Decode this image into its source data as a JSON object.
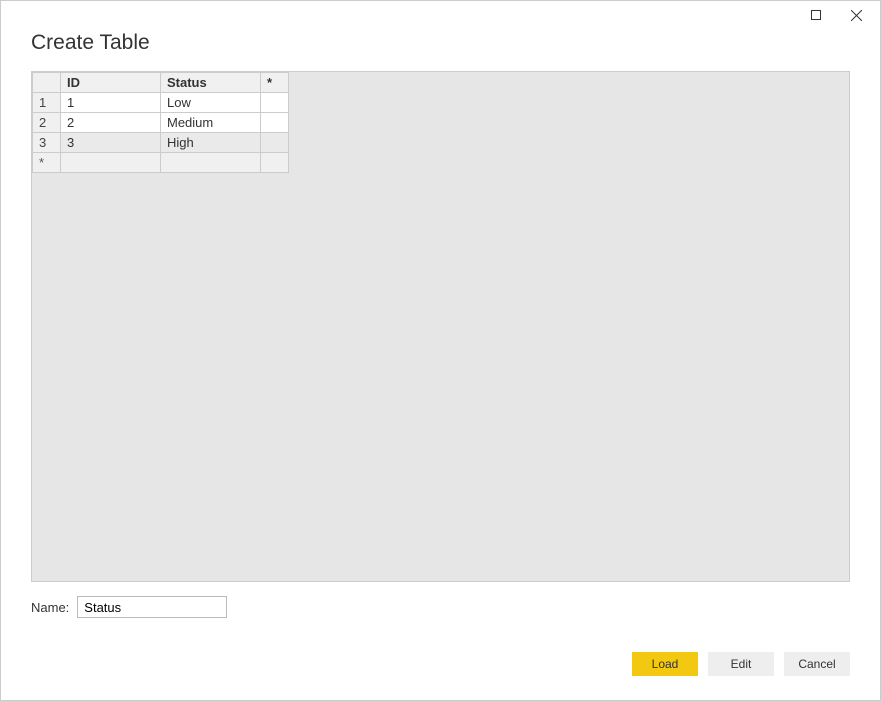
{
  "window": {
    "title": "Create Table"
  },
  "table": {
    "columns": [
      "ID",
      "Status"
    ],
    "add_col_marker": "*",
    "add_row_marker": "*",
    "rows": [
      {
        "num": "1",
        "id": "1",
        "status": "Low",
        "selected": false
      },
      {
        "num": "2",
        "id": "2",
        "status": "Medium",
        "selected": false
      },
      {
        "num": "3",
        "id": "3",
        "status": "High",
        "selected": true
      }
    ]
  },
  "name_field": {
    "label": "Name:",
    "value": "Status"
  },
  "buttons": {
    "load": "Load",
    "edit": "Edit",
    "cancel": "Cancel"
  }
}
